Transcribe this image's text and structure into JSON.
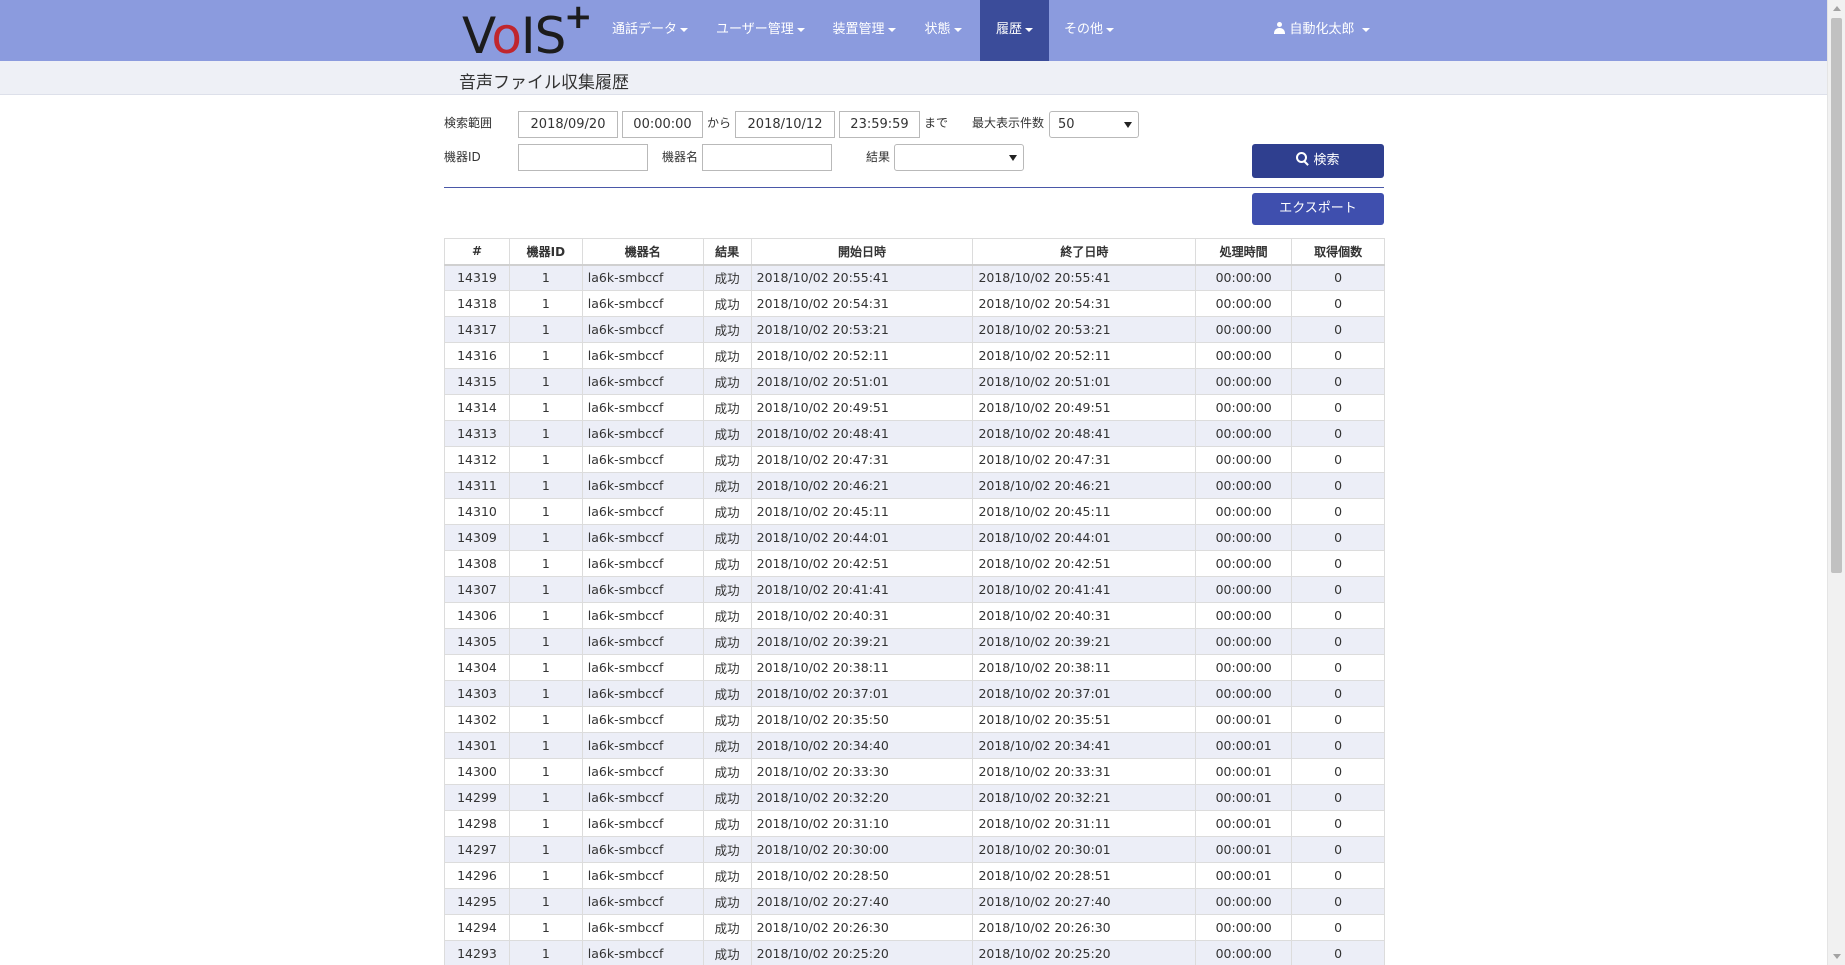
{
  "brand": {
    "logo_text_v": "V",
    "logo_text_o": "o",
    "logo_text_is": "IS",
    "logo_plus": "+"
  },
  "nav": {
    "items": [
      {
        "label": "通話データ"
      },
      {
        "label": "ユーザー管理"
      },
      {
        "label": "装置管理"
      },
      {
        "label": "状態"
      },
      {
        "label": "履歴",
        "active": true
      },
      {
        "label": "その他"
      }
    ],
    "user": "自動化太郎"
  },
  "colors": {
    "navbar": "#8b9bde",
    "nav_active": "#3b4c9a",
    "btn_search": "#2f3f8f",
    "btn_export": "#3f4fae",
    "row_stripe": "#eceef7"
  },
  "page": {
    "title": "音声ファイル収集履歴"
  },
  "search": {
    "range_label": "検索範囲",
    "start_date": "2018/09/20",
    "start_time": "00:00:00",
    "from_label": "から",
    "end_date": "2018/10/12",
    "end_time": "23:59:59",
    "until_label": "まで",
    "max_label": "最大表示件数",
    "max_value": "50",
    "device_id_label": "機器ID",
    "device_id_value": "",
    "device_name_label": "機器名",
    "device_name_value": "",
    "result_label": "結果",
    "result_value": "",
    "search_button": "検索",
    "export_button": "エクスポート"
  },
  "table": {
    "headers": [
      "#",
      "機器ID",
      "機器名",
      "結果",
      "開始日時",
      "終了日時",
      "処理時間",
      "取得個数"
    ],
    "rows": [
      [
        "14319",
        "1",
        "la6k-smbccf",
        "成功",
        "2018/10/02 20:55:41",
        "2018/10/02 20:55:41",
        "00:00:00",
        "0"
      ],
      [
        "14318",
        "1",
        "la6k-smbccf",
        "成功",
        "2018/10/02 20:54:31",
        "2018/10/02 20:54:31",
        "00:00:00",
        "0"
      ],
      [
        "14317",
        "1",
        "la6k-smbccf",
        "成功",
        "2018/10/02 20:53:21",
        "2018/10/02 20:53:21",
        "00:00:00",
        "0"
      ],
      [
        "14316",
        "1",
        "la6k-smbccf",
        "成功",
        "2018/10/02 20:52:11",
        "2018/10/02 20:52:11",
        "00:00:00",
        "0"
      ],
      [
        "14315",
        "1",
        "la6k-smbccf",
        "成功",
        "2018/10/02 20:51:01",
        "2018/10/02 20:51:01",
        "00:00:00",
        "0"
      ],
      [
        "14314",
        "1",
        "la6k-smbccf",
        "成功",
        "2018/10/02 20:49:51",
        "2018/10/02 20:49:51",
        "00:00:00",
        "0"
      ],
      [
        "14313",
        "1",
        "la6k-smbccf",
        "成功",
        "2018/10/02 20:48:41",
        "2018/10/02 20:48:41",
        "00:00:00",
        "0"
      ],
      [
        "14312",
        "1",
        "la6k-smbccf",
        "成功",
        "2018/10/02 20:47:31",
        "2018/10/02 20:47:31",
        "00:00:00",
        "0"
      ],
      [
        "14311",
        "1",
        "la6k-smbccf",
        "成功",
        "2018/10/02 20:46:21",
        "2018/10/02 20:46:21",
        "00:00:00",
        "0"
      ],
      [
        "14310",
        "1",
        "la6k-smbccf",
        "成功",
        "2018/10/02 20:45:11",
        "2018/10/02 20:45:11",
        "00:00:00",
        "0"
      ],
      [
        "14309",
        "1",
        "la6k-smbccf",
        "成功",
        "2018/10/02 20:44:01",
        "2018/10/02 20:44:01",
        "00:00:00",
        "0"
      ],
      [
        "14308",
        "1",
        "la6k-smbccf",
        "成功",
        "2018/10/02 20:42:51",
        "2018/10/02 20:42:51",
        "00:00:00",
        "0"
      ],
      [
        "14307",
        "1",
        "la6k-smbccf",
        "成功",
        "2018/10/02 20:41:41",
        "2018/10/02 20:41:41",
        "00:00:00",
        "0"
      ],
      [
        "14306",
        "1",
        "la6k-smbccf",
        "成功",
        "2018/10/02 20:40:31",
        "2018/10/02 20:40:31",
        "00:00:00",
        "0"
      ],
      [
        "14305",
        "1",
        "la6k-smbccf",
        "成功",
        "2018/10/02 20:39:21",
        "2018/10/02 20:39:21",
        "00:00:00",
        "0"
      ],
      [
        "14304",
        "1",
        "la6k-smbccf",
        "成功",
        "2018/10/02 20:38:11",
        "2018/10/02 20:38:11",
        "00:00:00",
        "0"
      ],
      [
        "14303",
        "1",
        "la6k-smbccf",
        "成功",
        "2018/10/02 20:37:01",
        "2018/10/02 20:37:01",
        "00:00:00",
        "0"
      ],
      [
        "14302",
        "1",
        "la6k-smbccf",
        "成功",
        "2018/10/02 20:35:50",
        "2018/10/02 20:35:51",
        "00:00:01",
        "0"
      ],
      [
        "14301",
        "1",
        "la6k-smbccf",
        "成功",
        "2018/10/02 20:34:40",
        "2018/10/02 20:34:41",
        "00:00:01",
        "0"
      ],
      [
        "14300",
        "1",
        "la6k-smbccf",
        "成功",
        "2018/10/02 20:33:30",
        "2018/10/02 20:33:31",
        "00:00:01",
        "0"
      ],
      [
        "14299",
        "1",
        "la6k-smbccf",
        "成功",
        "2018/10/02 20:32:20",
        "2018/10/02 20:32:21",
        "00:00:01",
        "0"
      ],
      [
        "14298",
        "1",
        "la6k-smbccf",
        "成功",
        "2018/10/02 20:31:10",
        "2018/10/02 20:31:11",
        "00:00:01",
        "0"
      ],
      [
        "14297",
        "1",
        "la6k-smbccf",
        "成功",
        "2018/10/02 20:30:00",
        "2018/10/02 20:30:01",
        "00:00:01",
        "0"
      ],
      [
        "14296",
        "1",
        "la6k-smbccf",
        "成功",
        "2018/10/02 20:28:50",
        "2018/10/02 20:28:51",
        "00:00:01",
        "0"
      ],
      [
        "14295",
        "1",
        "la6k-smbccf",
        "成功",
        "2018/10/02 20:27:40",
        "2018/10/02 20:27:40",
        "00:00:00",
        "0"
      ],
      [
        "14294",
        "1",
        "la6k-smbccf",
        "成功",
        "2018/10/02 20:26:30",
        "2018/10/02 20:26:30",
        "00:00:00",
        "0"
      ],
      [
        "14293",
        "1",
        "la6k-smbccf",
        "成功",
        "2018/10/02 20:25:20",
        "2018/10/02 20:25:20",
        "00:00:00",
        "0"
      ]
    ]
  }
}
